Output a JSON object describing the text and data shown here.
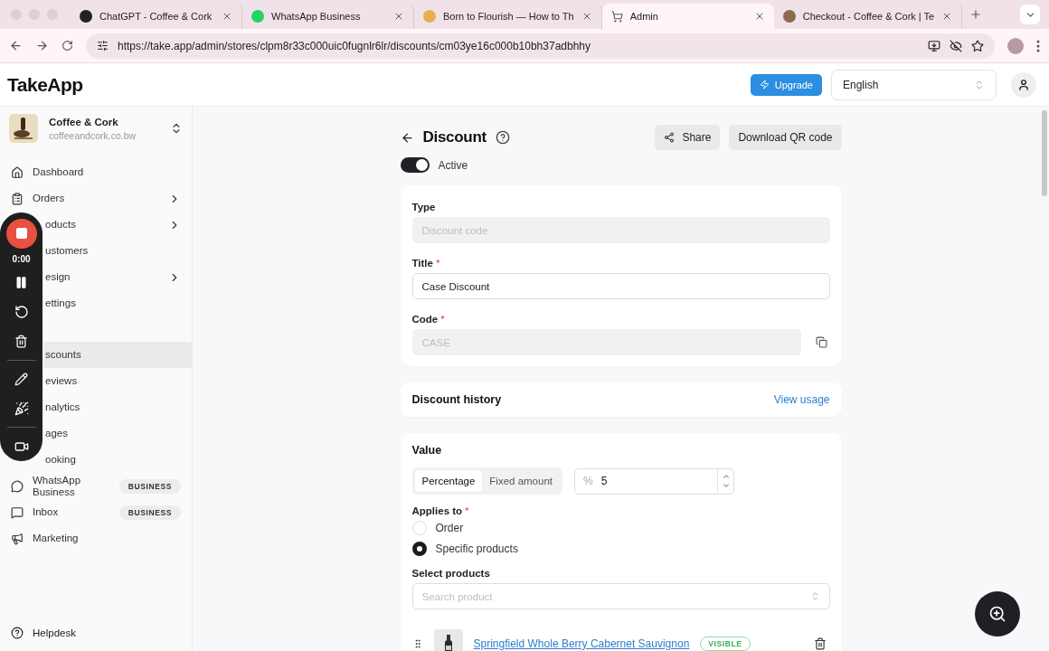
{
  "browser": {
    "tabs": [
      {
        "title": "ChatGPT - Coffee & Cork",
        "selected": false
      },
      {
        "title": "WhatsApp Business",
        "selected": false
      },
      {
        "title": "Born to Flourish — How to Th",
        "selected": false
      },
      {
        "title": "Admin",
        "selected": true
      },
      {
        "title": "Checkout - Coffee & Cork | Te",
        "selected": false
      }
    ],
    "url": "https://take.app/admin/stores/clpm8r33c000uic0fugnlr6lr/discounts/cm03ye16c000b10bh37adbhhy"
  },
  "header": {
    "logo": "TakeApp",
    "upgrade": "Upgrade",
    "language": "English"
  },
  "store": {
    "name": "Coffee & Cork",
    "domain": "coffeeandcork.co.bw"
  },
  "sidebar": {
    "items": [
      {
        "label": "Dashboard",
        "covered": false,
        "chevron": false,
        "selected": false
      },
      {
        "label": "Orders",
        "covered": false,
        "chevron": true,
        "selected": false
      },
      {
        "label": "oducts",
        "covered": true,
        "chevron": true,
        "selected": false
      },
      {
        "label": "ustomers",
        "covered": true,
        "chevron": false,
        "selected": false
      },
      {
        "label": "esign",
        "covered": true,
        "chevron": true,
        "selected": false
      },
      {
        "label": "ettings",
        "covered": true,
        "chevron": false,
        "selected": false,
        "gap_after": true
      },
      {
        "label": "scounts",
        "covered": true,
        "chevron": false,
        "selected": true
      },
      {
        "label": "eviews",
        "covered": true,
        "chevron": false,
        "selected": false
      },
      {
        "label": "nalytics",
        "covered": true,
        "chevron": false,
        "selected": false
      },
      {
        "label": "ages",
        "covered": true,
        "chevron": false,
        "selected": false
      },
      {
        "label": "ooking",
        "covered": true,
        "chevron": false,
        "selected": false
      },
      {
        "label": "WhatsApp Business",
        "covered": false,
        "chevron": false,
        "selected": false,
        "badge": "BUSINESS"
      },
      {
        "label": "Inbox",
        "covered": false,
        "chevron": false,
        "selected": false,
        "badge": "BUSINESS"
      },
      {
        "label": "Marketing",
        "covered": false,
        "chevron": false,
        "selected": false
      }
    ],
    "footer": "Helpdesk"
  },
  "recorder": {
    "time": "0:00"
  },
  "discount": {
    "title": "Discount",
    "share": "Share",
    "download": "Download QR code",
    "active": {
      "label": "Active",
      "on": true
    },
    "type": {
      "label": "Type",
      "placeholder": "Discount code"
    },
    "title_field": {
      "label": "Title",
      "required": "*",
      "value": "Case Discount"
    },
    "code": {
      "label": "Code",
      "required": "*",
      "placeholder": "CASE"
    },
    "history": {
      "label": "Discount history",
      "link": "View usage"
    },
    "value": {
      "label": "Value",
      "modes": [
        {
          "label": "Percentage",
          "selected": true
        },
        {
          "label": "Fixed amount",
          "selected": false
        }
      ],
      "prefix": "%",
      "amount": "5"
    },
    "applies": {
      "label": "Applies to",
      "required": "*",
      "options": [
        {
          "label": "Order",
          "selected": false
        },
        {
          "label": "Specific products",
          "selected": true
        }
      ]
    },
    "products": {
      "label": "Select products",
      "placeholder": "Search product",
      "items": [
        {
          "name": "Springfield Whole Berry Cabernet Sauvignon",
          "status": "VISIBLE"
        }
      ]
    }
  }
}
